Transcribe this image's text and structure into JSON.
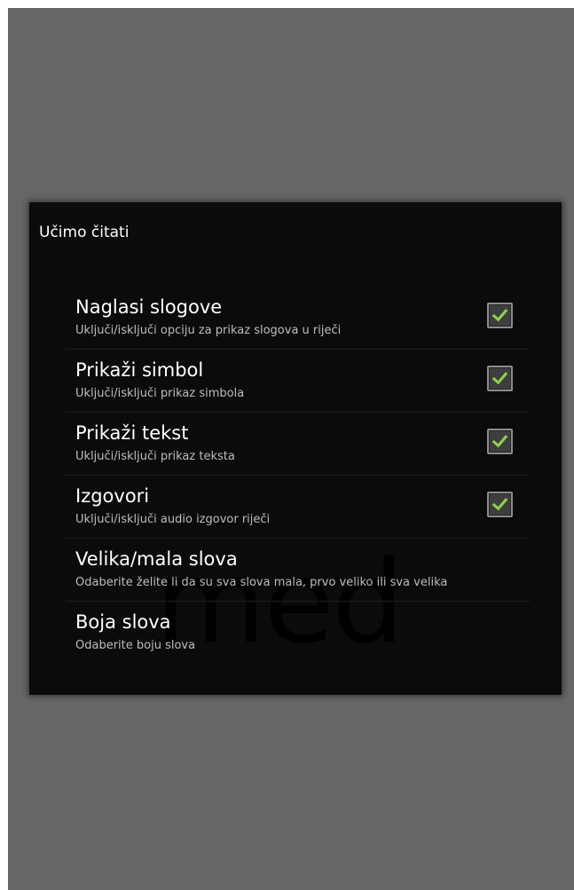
{
  "dialog": {
    "title": "Učimo čitati",
    "watermark": "med"
  },
  "preferences": [
    {
      "title": "Naglasi slogove",
      "summary": "Uključi/isključi opciju za prikaz slogova u riječi",
      "checked": true
    },
    {
      "title": "Prikaži simbol",
      "summary": "Uključi/isključi prikaz simbola",
      "checked": true
    },
    {
      "title": "Prikaži tekst",
      "summary": "Uključi/isključi prikaz teksta",
      "checked": true
    },
    {
      "title": "Izgovori",
      "summary": "Uključi/isključi audio izgovor riječi",
      "checked": true
    },
    {
      "title": "Velika/mala slova",
      "summary": "Odaberite želite li da su sva slova mala, prvo veliko ili sva velika"
    },
    {
      "title": "Boja slova",
      "summary": "Odaberite boju slova"
    }
  ],
  "colors": {
    "background": "#666666",
    "dialog": "#0b0b0b",
    "checkmark": "#8fd14f"
  },
  "icons": {
    "checkbox_checked": "check-icon"
  }
}
